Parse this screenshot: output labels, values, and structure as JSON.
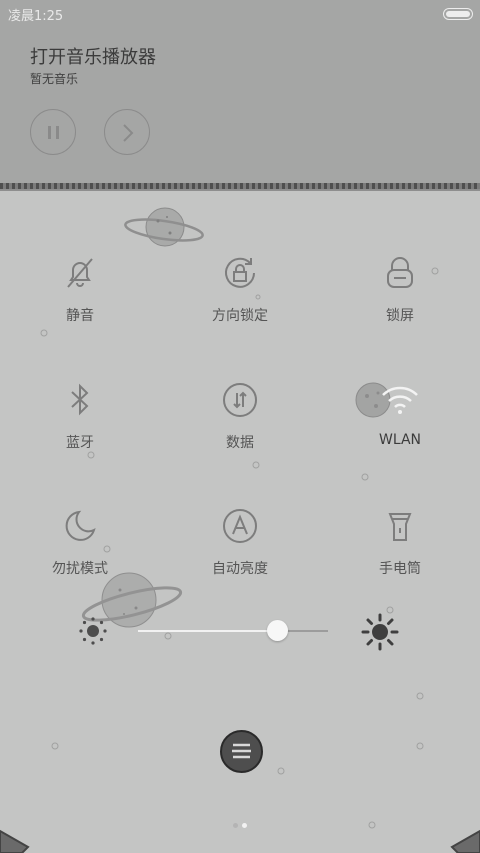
{
  "status_bar": {
    "time": "凌晨1:25"
  },
  "music": {
    "title": "打开音乐播放器",
    "subtitle": "暂无音乐"
  },
  "toggles": [
    {
      "label": "静音",
      "icon": "bell-off-icon"
    },
    {
      "label": "方向锁定",
      "icon": "rotation-lock-icon"
    },
    {
      "label": "锁屏",
      "icon": "lock-icon"
    },
    {
      "label": "蓝牙",
      "icon": "bluetooth-icon"
    },
    {
      "label": "数据",
      "icon": "mobile-data-icon"
    },
    {
      "label": "WLAN",
      "icon": "wifi-icon"
    },
    {
      "label": "勿扰模式",
      "icon": "moon-icon"
    },
    {
      "label": "自动亮度",
      "icon": "auto-brightness-icon"
    },
    {
      "label": "手电筒",
      "icon": "flashlight-icon"
    }
  ],
  "brightness": {
    "level": 0.73
  },
  "pager": {
    "pages": 2,
    "current": 2
  },
  "colors": {
    "background": "#c4c5c4",
    "top_background": "#a5a6a5",
    "icon": "#7d7d7d"
  }
}
